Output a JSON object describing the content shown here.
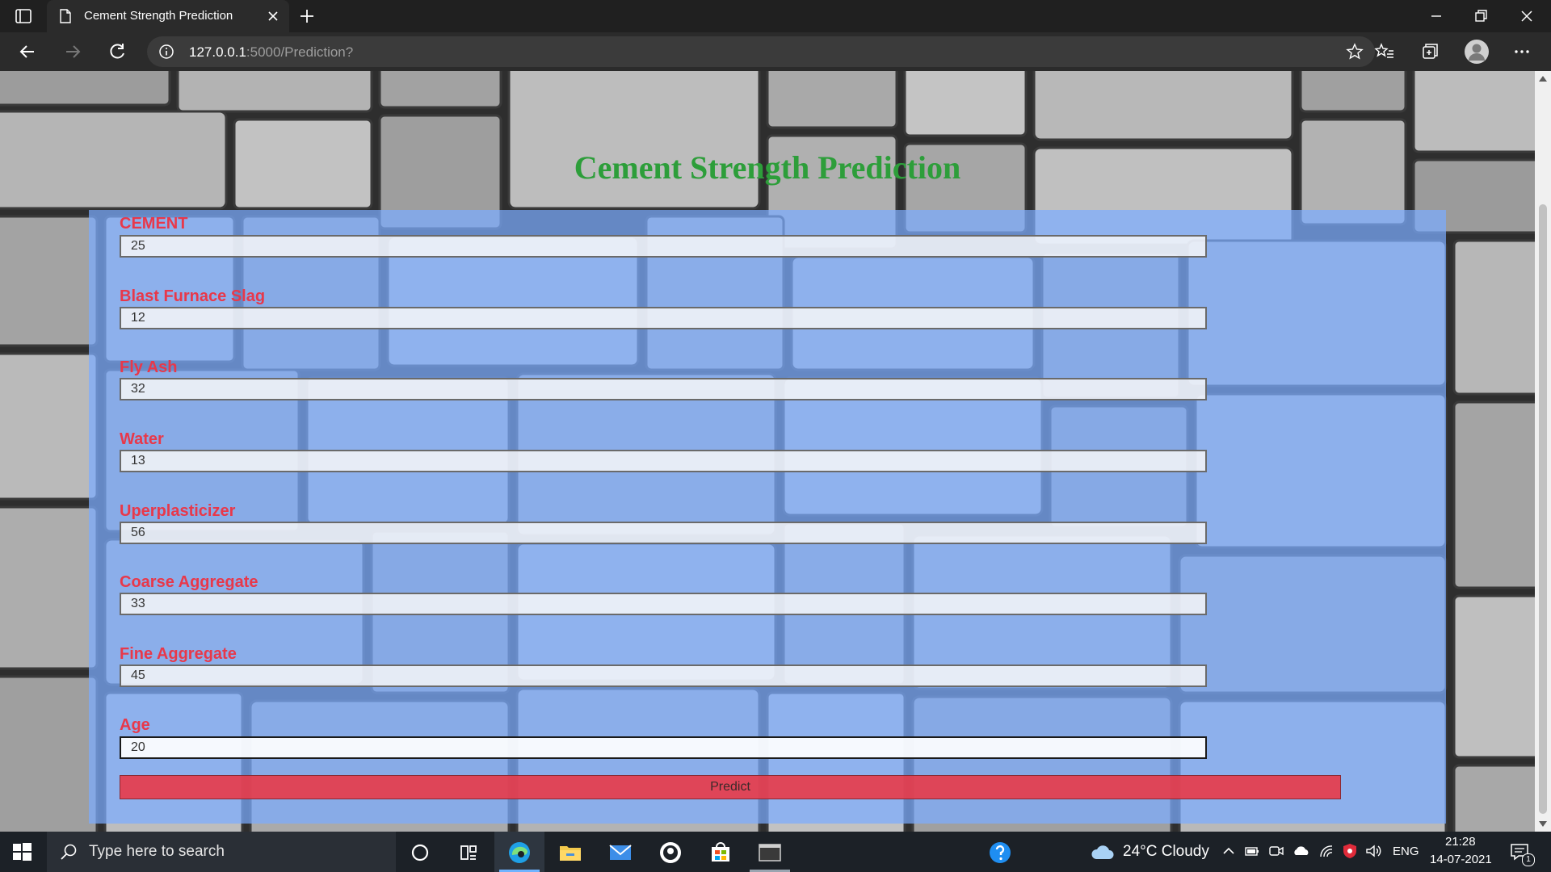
{
  "browser": {
    "tab_title": "Cement Strength Prediction",
    "url_host": "127.0.0.1",
    "url_rest": ":5000/Prediction?"
  },
  "page": {
    "heading": "Cement Strength Prediction",
    "fields": [
      {
        "label": "CEMENT",
        "value": "25"
      },
      {
        "label": "Blast Furnace Slag",
        "value": "12"
      },
      {
        "label": "Fly Ash",
        "value": "32"
      },
      {
        "label": "Water",
        "value": "13"
      },
      {
        "label": "Uperplasticizer",
        "value": "56"
      },
      {
        "label": "Coarse Aggregate",
        "value": "33"
      },
      {
        "label": "Fine Aggregate",
        "value": "45"
      },
      {
        "label": "Age",
        "value": "20"
      }
    ],
    "predict_label": "Predict"
  },
  "taskbar": {
    "search_placeholder": "Type here to search",
    "weather": "24°C  Cloudy",
    "language": "ENG",
    "time": "21:28",
    "date": "14-07-2021",
    "notification_count": "1"
  },
  "colors": {
    "heading": "#2d9e3a",
    "label": "#e8384a",
    "panel": "#7cacff",
    "button": "#e83a48"
  }
}
